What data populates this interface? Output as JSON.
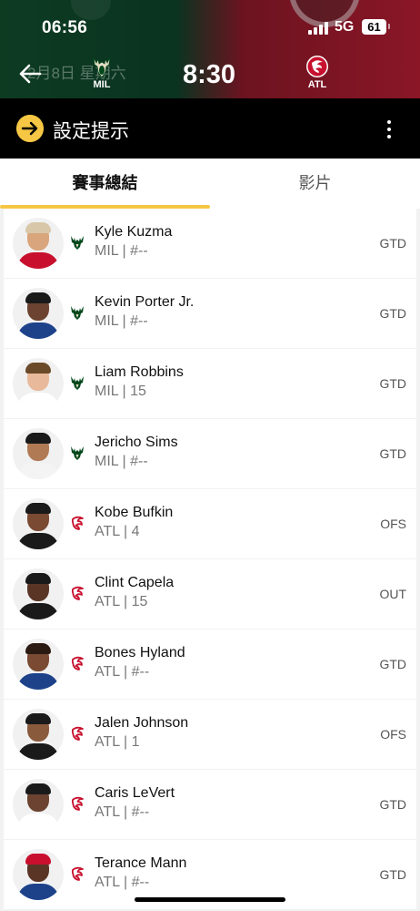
{
  "status_bar": {
    "time": "06:56",
    "network": "5G",
    "battery": "61"
  },
  "game": {
    "date_faded": "2月8日 星期六",
    "clock": "8:30",
    "away": {
      "abbr": "MIL",
      "logo": "bucks-logo-icon",
      "color": "#00471b"
    },
    "home": {
      "abbr": "ATL",
      "logo": "hawks-logo-icon",
      "color": "#c8102e"
    }
  },
  "banner": {
    "title": "設定提示",
    "icon": "arrow-right-circle-icon",
    "accent": "#f6c744"
  },
  "tabs": [
    {
      "label": "賽事總結",
      "active": true
    },
    {
      "label": "影片",
      "active": false
    }
  ],
  "players": [
    {
      "name": "Kyle Kuzma",
      "meta": "MIL | #--",
      "status": "GTD",
      "team": "MIL",
      "jersey_color": "#c8102e",
      "skin": "#d9a57c",
      "hair": "#d8c7a8"
    },
    {
      "name": "Kevin Porter Jr.",
      "meta": "MIL | #--",
      "status": "GTD",
      "team": "MIL",
      "jersey_color": "#1d428a",
      "skin": "#6b4330",
      "hair": "#1a1a1a"
    },
    {
      "name": "Liam Robbins",
      "meta": "MIL | 15",
      "status": "GTD",
      "team": "MIL",
      "jersey_color": "#ffffff",
      "skin": "#e8b99a",
      "hair": "#6b4a2a"
    },
    {
      "name": "Jericho Sims",
      "meta": "MIL | #--",
      "status": "GTD",
      "team": "MIL",
      "jersey_color": "#f4f4f4",
      "skin": "#b07a55",
      "hair": "#1a1a1a"
    },
    {
      "name": "Kobe Bufkin",
      "meta": "ATL | 4",
      "status": "OFS",
      "team": "ATL",
      "jersey_color": "#1a1a1a",
      "skin": "#7a4a32",
      "hair": "#1a1a1a"
    },
    {
      "name": "Clint Capela",
      "meta": "ATL | 15",
      "status": "OUT",
      "team": "ATL",
      "jersey_color": "#1a1a1a",
      "skin": "#5a3526",
      "hair": "#1a1a1a"
    },
    {
      "name": "Bones Hyland",
      "meta": "ATL | #--",
      "status": "GTD",
      "team": "ATL",
      "jersey_color": "#1d428a",
      "skin": "#7a4a32",
      "hair": "#2a1a12"
    },
    {
      "name": "Jalen Johnson",
      "meta": "ATL | 1",
      "status": "OFS",
      "team": "ATL",
      "jersey_color": "#1a1a1a",
      "skin": "#8a5a3c",
      "hair": "#1a1a1a"
    },
    {
      "name": "Caris LeVert",
      "meta": "ATL | #--",
      "status": "GTD",
      "team": "ATL",
      "jersey_color": "#ffffff",
      "skin": "#6b4330",
      "hair": "#1a1a1a"
    },
    {
      "name": "Terance Mann",
      "meta": "ATL | #--",
      "status": "GTD",
      "team": "ATL",
      "jersey_color": "#1d428a",
      "skin": "#5a3526",
      "hair": "#c8102e"
    }
  ]
}
